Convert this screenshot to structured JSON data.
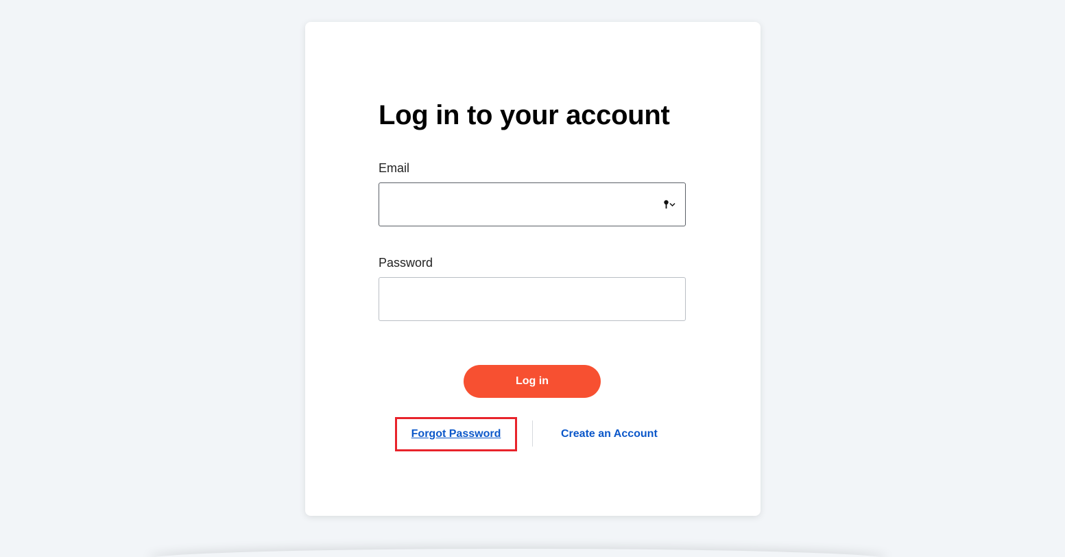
{
  "form": {
    "title": "Log in to your account",
    "email_label": "Email",
    "email_value": "",
    "password_label": "Password",
    "password_value": "",
    "login_label": "Log in",
    "forgot_label": "Forgot Password",
    "create_label": "Create an Account"
  },
  "icons": {
    "autofill": "key-chevron-down-icon"
  },
  "colors": {
    "page_bg": "#f2f5f8",
    "card_bg": "#ffffff",
    "primary_button": "#f75031",
    "link": "#0b57c9",
    "highlight_box": "#e8232b"
  }
}
